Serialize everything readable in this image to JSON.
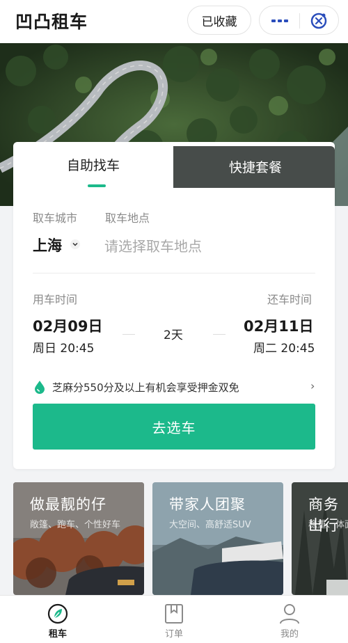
{
  "header": {
    "title": "凹凸租车",
    "favorite_label": "已收藏"
  },
  "tabs": [
    {
      "label": "自助找车",
      "active": true
    },
    {
      "label": "快捷套餐",
      "active": false
    }
  ],
  "pickup": {
    "city_label": "取车城市",
    "city_value": "上海",
    "location_label": "取车地点",
    "location_placeholder": "请选择取车地点"
  },
  "time": {
    "start_label": "用车时间",
    "start_date": "02月09日",
    "start_weekday_time": "周日 20:45",
    "duration": "2天",
    "end_label": "还车时间",
    "end_date": "02月11日",
    "end_weekday_time": "周二 20:45"
  },
  "tip": {
    "text": "芝麻分550分及以上有机会享受押金双免",
    "arrow": "›"
  },
  "primary_button": "去选车",
  "promos": [
    {
      "title": "做最靓的仔",
      "subtitle": "敞篷、跑车、个性好车"
    },
    {
      "title": "带家人团聚",
      "subtitle": "大空间、高舒适SUV"
    },
    {
      "title": "商务出行",
      "subtitle": "稳重、体面"
    }
  ],
  "bottom_nav": [
    {
      "label": "租车",
      "active": true,
      "icon": "car-rental-icon"
    },
    {
      "label": "订单",
      "active": false,
      "icon": "order-icon"
    },
    {
      "label": "我的",
      "active": false,
      "icon": "profile-icon"
    }
  ],
  "colors": {
    "accent": "#1cb98b",
    "text_primary": "#1a1a1a",
    "text_secondary": "#8a8a8a"
  }
}
